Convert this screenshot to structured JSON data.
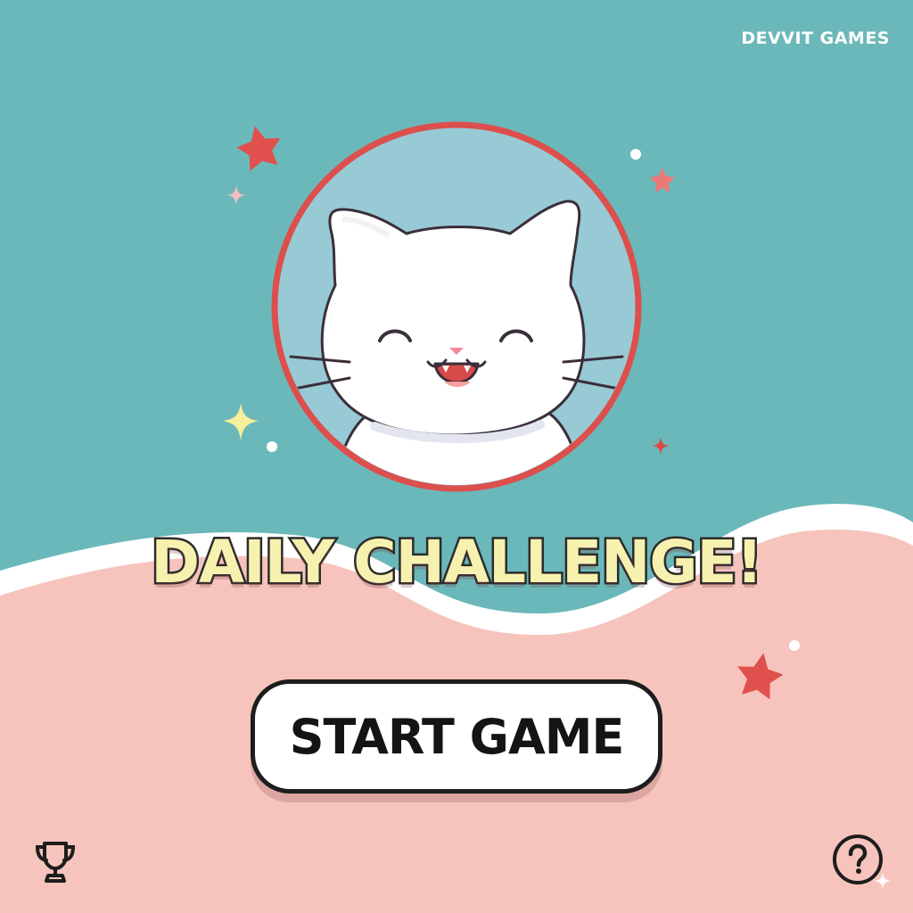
{
  "brand": {
    "label": "DEVVIT GAMES"
  },
  "hero": {
    "title": "DAILY CHALLENGE!"
  },
  "actions": {
    "start_label": "START GAME"
  },
  "icons": {
    "leaderboard": "trophy-icon",
    "help": "question-mark-icon",
    "mascot": "happy-white-cat"
  },
  "colors": {
    "sky": "#6bb8ba",
    "ground": "#f6c4bc",
    "wave": "#ffffff",
    "ring": "#dd4f4c",
    "portrait_bg": "#98cad5",
    "title_fill": "#f7f1b0",
    "star_red": "#e0504d",
    "star_yellow": "#f7ef9a"
  }
}
